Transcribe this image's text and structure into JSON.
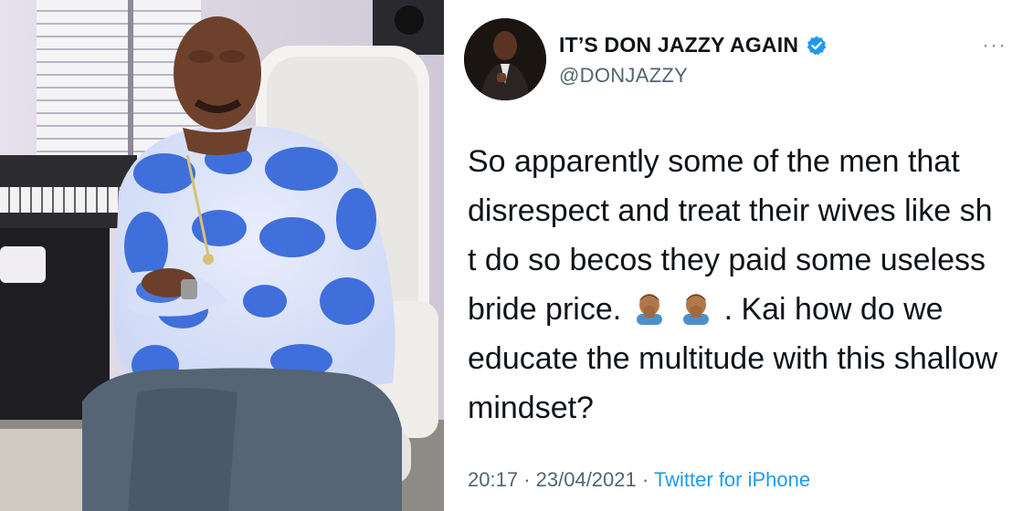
{
  "tweet": {
    "display_name": "IT’S DON JAZZY AGAIN",
    "handle": "@DONJAZZY",
    "more_label": "···",
    "text_before_emoji": "So apparently some of the men that disrespect and treat their wives like sh t do so becos they paid some useless bride price.",
    "text_after_emoji": ". Kai how do we educate the multitude with this shallow mindset?",
    "time": "20:17",
    "separator": "·",
    "date": "23/04/2021",
    "source": "Twitter for iPhone",
    "emoji_icon": "man-facepalming-icon",
    "verified_icon": "verified-badge-icon",
    "colors": {
      "verified": "#1d9bf0",
      "source_link": "#1d9bf0",
      "meta": "#536471"
    }
  },
  "photo": {
    "subject": "man-seated-in-studio-chair-image"
  }
}
